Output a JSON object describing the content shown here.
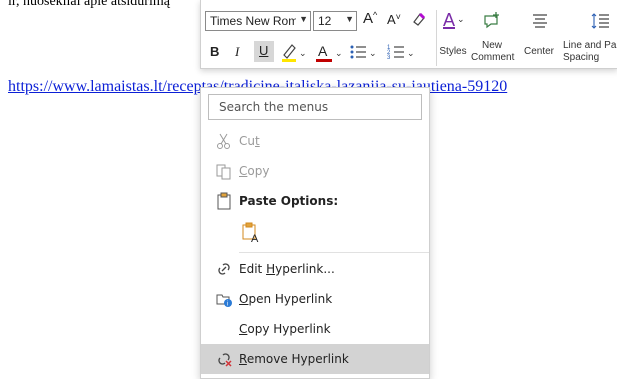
{
  "document": {
    "top_partial_line": "ir, nuosekliai apie atsidurimą",
    "link_text": "https://www.lamaistas.lt/receptas/tradicine-italiska-lazanija-su-jautiena-59120"
  },
  "mini_toolbar": {
    "font_name": "Times New Roman",
    "font_size": "12",
    "grow_font": "A^",
    "shrink_font": "A˅",
    "styles_label": "Styles",
    "new_comment_label": "New Comment",
    "center_label": "Center",
    "line_spacing_label": "Line and Paragraph Spacing",
    "accent_highlight": "#ffe600",
    "accent_fontcolor": "#c00000"
  },
  "context_menu": {
    "search_placeholder": "Search the menus",
    "items": [
      {
        "label": "Cut",
        "underline_index": 2,
        "icon": "scissors-icon",
        "enabled": false
      },
      {
        "label": "Copy",
        "underline_index": 0,
        "icon": "copy-icon",
        "enabled": false
      },
      {
        "label": "Paste Options:",
        "icon": "clipboard-icon",
        "enabled": true
      },
      {
        "label": "Edit Hyperlink...",
        "underline_index": 5,
        "icon": "link-icon",
        "enabled": true
      },
      {
        "label": "Open Hyperlink",
        "underline_index": 0,
        "icon": "open-folder-link-icon",
        "enabled": true
      },
      {
        "label": "Copy Hyperlink",
        "underline_index": 0,
        "icon": "",
        "enabled": true
      },
      {
        "label": "Remove Hyperlink",
        "underline_index": 0,
        "icon": "remove-link-icon",
        "enabled": true,
        "hovered": true
      }
    ]
  }
}
